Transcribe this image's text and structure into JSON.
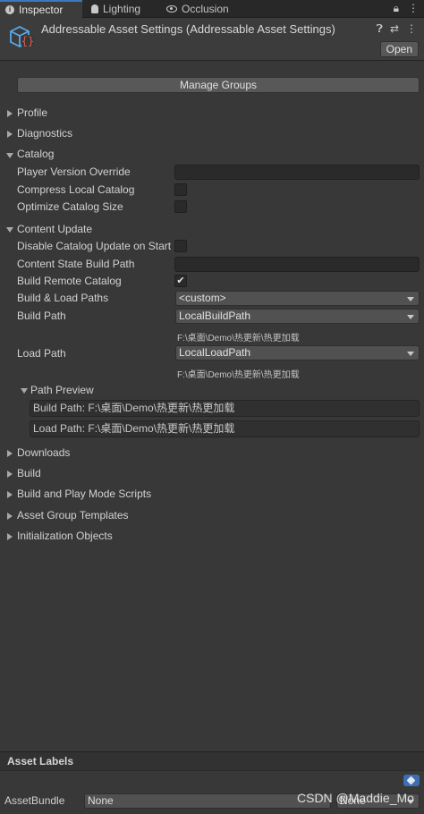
{
  "tabs": [
    {
      "label": "Inspector",
      "icon": "info-icon",
      "active": true
    },
    {
      "label": "Lighting",
      "icon": "lightbulb-icon",
      "active": false
    },
    {
      "label": "Occlusion",
      "icon": "eye-icon",
      "active": false
    }
  ],
  "header": {
    "title": "Addressable Asset Settings (Addressable Asset Settings)",
    "open_label": "Open"
  },
  "manage_groups_label": "Manage Groups",
  "sections": {
    "profile": "Profile",
    "diagnostics": "Diagnostics",
    "catalog": "Catalog",
    "content_update": "Content Update",
    "path_preview": "Path Preview",
    "downloads": "Downloads",
    "build": "Build",
    "build_play_mode": "Build and Play Mode Scripts",
    "asset_group_templates": "Asset Group Templates",
    "initialization_objects": "Initialization Objects"
  },
  "catalog": {
    "player_version_override": "Player Version Override",
    "compress_local_catalog": "Compress Local Catalog",
    "optimize_catalog_size": "Optimize Catalog Size"
  },
  "content_update": {
    "disable_catalog_update": "Disable Catalog Update on Start",
    "content_state_build_path": "Content State Build Path",
    "build_remote_catalog": "Build Remote Catalog",
    "build_remote_catalog_checked": true,
    "build_load_paths": "Build & Load Paths",
    "build_load_paths_value": "<custom>",
    "build_path": "Build Path",
    "build_path_value": "LocalBuildPath",
    "build_path_note": "F:\\桌面\\Demo\\热更新\\热更加载",
    "load_path": "Load Path",
    "load_path_value": "LocalLoadPath",
    "load_path_note": "F:\\桌面\\Demo\\热更新\\热更加载"
  },
  "path_preview": {
    "build_path_text": "Build Path: F:\\桌面\\Demo\\热更新\\热更加载",
    "load_path_text": "Load Path: F:\\桌面\\Demo\\热更新\\热更加载"
  },
  "asset_labels": {
    "title": "Asset Labels",
    "bundle_label": "AssetBundle",
    "bundle_value": "None",
    "variant_value": "None"
  },
  "watermark": "CSDN @Maddie_Mo",
  "colors": {
    "background": "#383838",
    "accent": "#3a79bb",
    "tag": "#3d6eb2"
  }
}
